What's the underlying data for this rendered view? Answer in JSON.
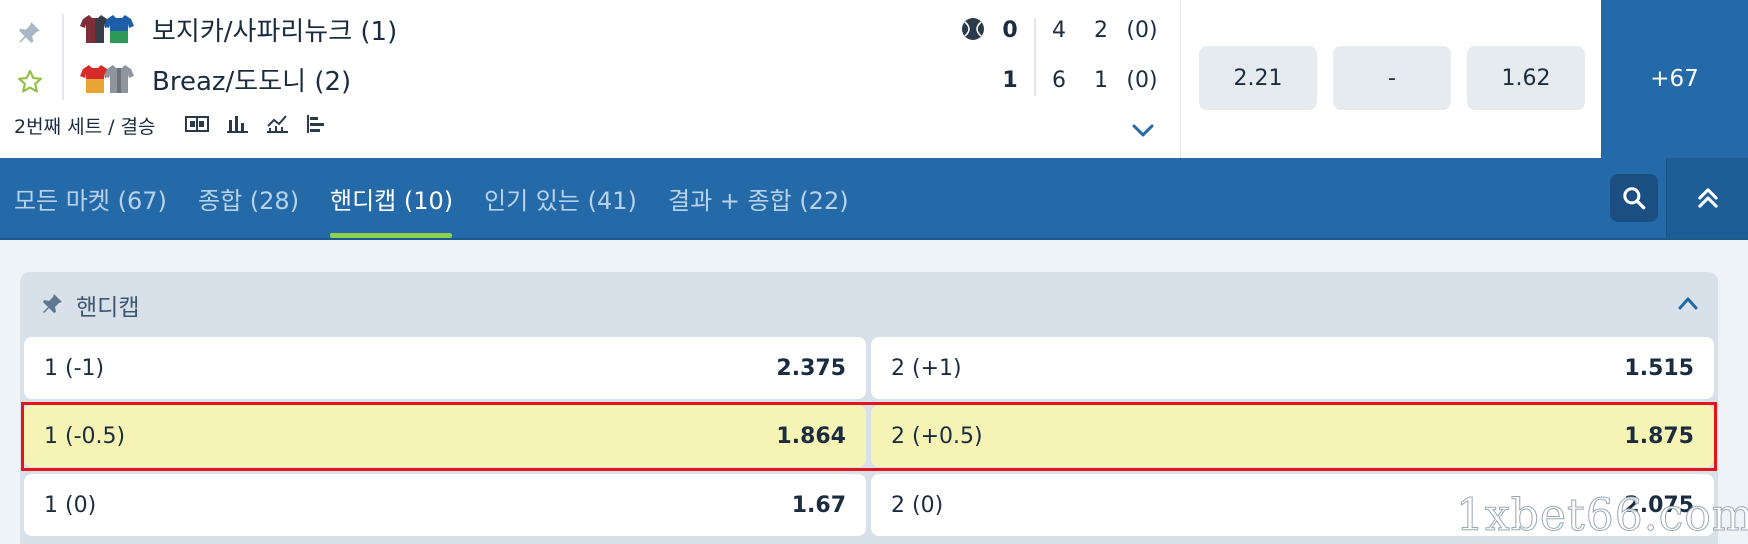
{
  "match": {
    "team1": {
      "name": "보지카/사파리뉴크 (1)"
    },
    "team2": {
      "name": "Breaz/도도니 (2)"
    },
    "score": {
      "team1": {
        "total": "0",
        "set1": "4",
        "set2": "2",
        "game": "(0)"
      },
      "team2": {
        "total": "1",
        "set1": "6",
        "set2": "1",
        "game": "(0)"
      }
    },
    "period": "2번째 세트 / 결승",
    "stat_icons": [
      "scoreboard-icon",
      "bar-chart-icon",
      "line-chart-icon",
      "list-chart-icon"
    ],
    "odds": [
      "2.21",
      "-",
      "1.62"
    ],
    "more_markets": "+67"
  },
  "tabs": [
    {
      "label": "모든 마켓 (67)",
      "active": false
    },
    {
      "label": "종합 (28)",
      "active": false
    },
    {
      "label": "핸디캡 (10)",
      "active": true
    },
    {
      "label": "인기 있는 (41)",
      "active": false
    },
    {
      "label": "결과 + 종합 (22)",
      "active": false
    }
  ],
  "market": {
    "title": "핸디캡",
    "rows": [
      {
        "left": {
          "label": "1 (-1)",
          "odd": "2.375"
        },
        "right": {
          "label": "2 (+1)",
          "odd": "1.515"
        },
        "highlighted": false
      },
      {
        "left": {
          "label": "1 (-0.5)",
          "odd": "1.864"
        },
        "right": {
          "label": "2 (+0.5)",
          "odd": "1.875"
        },
        "highlighted": true
      },
      {
        "left": {
          "label": "1 (0)",
          "odd": "1.67"
        },
        "right": {
          "label": "2 (0)",
          "odd": "2.075"
        },
        "highlighted": false
      }
    ]
  },
  "colors": {
    "header_blue": "#256aa8",
    "active_tab_underline": "#8fd14f",
    "highlight_row": "#f5f4b4",
    "highlight_border": "#e3141c"
  },
  "watermark": "1xbet66.com"
}
